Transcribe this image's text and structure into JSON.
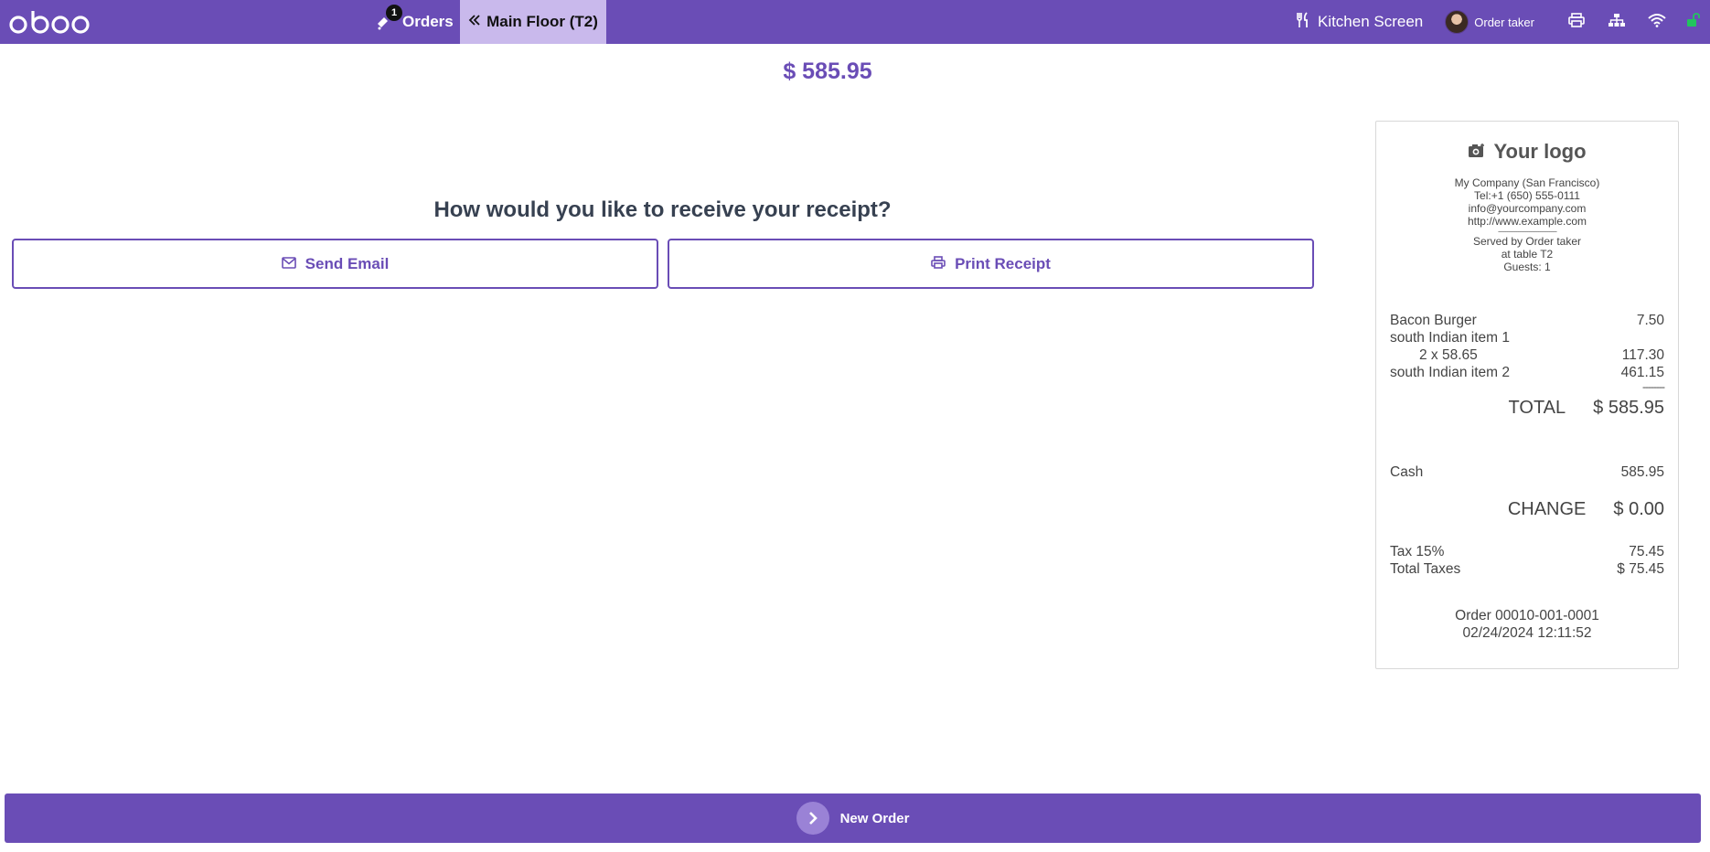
{
  "app": {
    "logo_text": "odoo"
  },
  "navbar": {
    "orders_label": "Orders",
    "orders_badge": "1",
    "floor_label": "Main Floor (T2)",
    "kitchen_label": "Kitchen Screen",
    "user_label": "Order taker",
    "accent_color": "#6a4db6",
    "unlock_icon_color": "#22c55e"
  },
  "main": {
    "amount": "$ 585.95",
    "question": "How would you like to receive your receipt?",
    "send_email_label": "Send Email",
    "print_receipt_label": "Print Receipt"
  },
  "receipt": {
    "logo_text": "Your logo",
    "company": "My Company (San Francisco)",
    "tel": "Tel:+1 (650) 555-0111",
    "email": "info@yourcompany.com",
    "website": "http://www.example.com",
    "separator": "--------------------------------",
    "served_by": "Served by Order taker",
    "table": "at table T2",
    "guests": "Guests: 1",
    "lines": [
      {
        "name": "Bacon Burger",
        "amount": "7.50"
      },
      {
        "name": "south Indian item 1",
        "amount": ""
      },
      {
        "name": "2 x 58.65",
        "amount": "117.30"
      },
      {
        "name": "south Indian item 2",
        "amount": "461.15"
      }
    ],
    "dashes": "--------",
    "total_label": "TOTAL",
    "total_value": "$ 585.95",
    "payment_label": "Cash",
    "payment_value": "585.95",
    "change_label": "CHANGE",
    "change_value": "$ 0.00",
    "tax_label": "Tax 15%",
    "tax_value": "75.45",
    "total_taxes_label": "Total Taxes",
    "total_taxes_value": "$ 75.45",
    "order_ref": "Order 00010-001-0001",
    "order_date": "02/24/2024 12:11:52"
  },
  "bottom": {
    "new_order_label": "New Order"
  }
}
